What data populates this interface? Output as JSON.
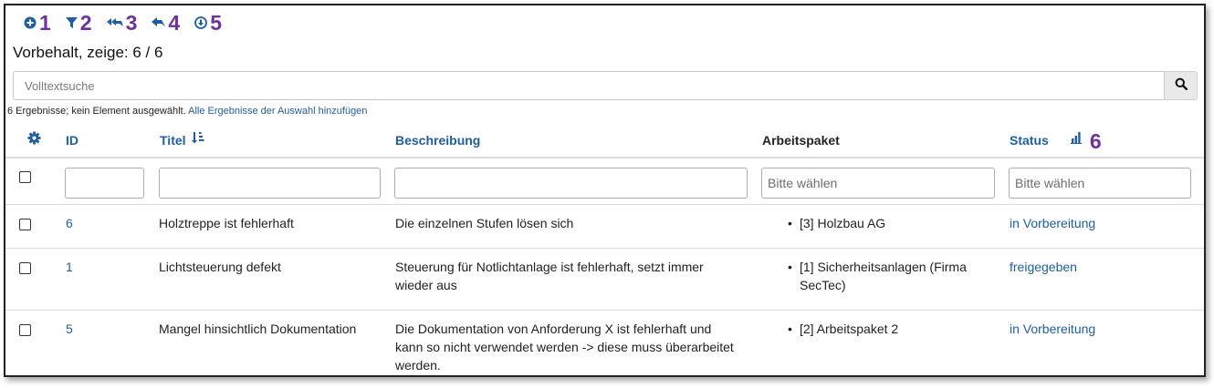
{
  "toolbar": {
    "items": [
      {
        "icon": "plus-circle-icon",
        "badge": "1"
      },
      {
        "icon": "filter-icon",
        "badge": "2"
      },
      {
        "icon": "double-reply-icon",
        "badge": "3"
      },
      {
        "icon": "reply-icon",
        "badge": "4"
      },
      {
        "icon": "download-circle-icon",
        "badge": "5"
      }
    ]
  },
  "heading": "Vorbehalt, zeige: 6 / 6",
  "search": {
    "placeholder": "Volltextsuche"
  },
  "info": {
    "text": "6 Ergebnisse; kein Element ausgewählt.",
    "link": "Alle Ergebnisse der Auswahl hinzufügen"
  },
  "table": {
    "columns": {
      "settings_icon": "gear-icon",
      "id": "ID",
      "title": "Titel",
      "title_sort_icon": "sort-descending-icon",
      "description": "Beschreibung",
      "work_package": "Arbeitspaket",
      "status": "Status",
      "chart_icon": "bar-chart-icon",
      "chart_badge": "6"
    },
    "filters": {
      "work_package_placeholder": "Bitte wählen",
      "status_placeholder": "Bitte wählen"
    },
    "rows": [
      {
        "id": "6",
        "title": "Holztreppe ist fehlerhaft",
        "description": [
          "Die einzelnen Stufen lösen sich"
        ],
        "work_package": [
          "[3] Holzbau AG"
        ],
        "status": "in Vorbereitung"
      },
      {
        "id": "1",
        "title": "Lichtsteuerung defekt",
        "description": [
          "Steuerung für Notlichtanlage ist fehlerhaft, setzt immer",
          "wieder aus"
        ],
        "work_package": [
          "[1] Sicherheitsanlagen (Firma",
          "SecTec)"
        ],
        "status": "freigegeben"
      },
      {
        "id": "5",
        "title": "Mangel hinsichtlich Dokumentation",
        "description": [
          "Die Dokumentation von Anforderung X ist fehlerhaft und",
          "kann so nicht verwendet werden -> diese muss überarbeitet",
          "werden."
        ],
        "work_package": [
          "[2] Arbeitspaket 2"
        ],
        "status": "in Vorbereitung"
      }
    ]
  },
  "colors": {
    "link": "#1f5fa0",
    "badge": "#7030a0",
    "border": "#dcdcdc"
  }
}
